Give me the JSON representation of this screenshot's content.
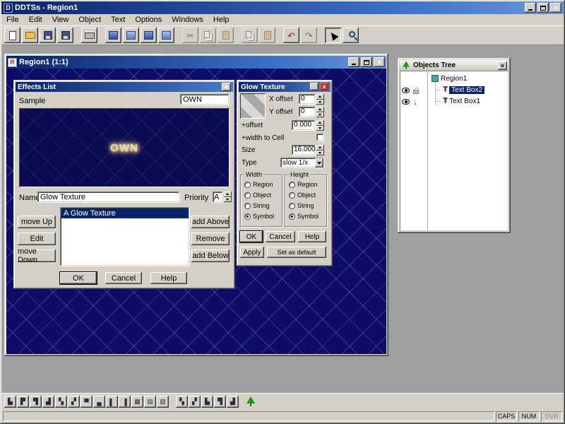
{
  "app": {
    "title": "DDTSs - Region1",
    "menu": [
      "File",
      "Edit",
      "View",
      "Object",
      "Text",
      "Options",
      "Windows",
      "Help"
    ],
    "statusbar": {
      "caps": "CAPS",
      "num": "NUM",
      "ovr": "OVR"
    }
  },
  "region_window": {
    "title": "Region1  (1:1)"
  },
  "effects": {
    "title": "Effects List",
    "sample_label": "Sample",
    "sample_value": "OWN",
    "preview_text": "OWN",
    "name_label": "Name",
    "name_value": "Glow Texture",
    "priority_label": "Priority",
    "priority_value": "A",
    "list_items": [
      "A Glow Texture"
    ],
    "btn_move_up": "move Up",
    "btn_edit": "Edit",
    "btn_move_down": "move Down",
    "btn_add_above": "add Above",
    "btn_remove": "Remove",
    "btn_add_below": "add Below",
    "btn_ok": "OK",
    "btn_cancel": "Cancel",
    "btn_help": "Help"
  },
  "glow": {
    "title": "Glow Texture",
    "x_offset_label": "X offset",
    "x_offset_value": "0",
    "y_offset_label": "Y offset",
    "y_offset_value": "0",
    "plus_offset_label": "+offset",
    "plus_offset_value": "0.000",
    "width_to_cell_label": "+width to Cell",
    "size_label": "Size",
    "size_value": "16.000",
    "type_label": "Type",
    "type_value": "slow 1/x",
    "width_group": {
      "label": "Width",
      "options": [
        "Region",
        "Object",
        "String",
        "Symbol"
      ],
      "selected": "Symbol"
    },
    "height_group": {
      "label": "Height",
      "options": [
        "Region",
        "Object",
        "String",
        "Symbol"
      ],
      "selected": "Symbol"
    },
    "btn_ok": "OK",
    "btn_cancel": "Cancel",
    "btn_help": "Help",
    "btn_apply": "Apply",
    "btn_set_default": "Set as default"
  },
  "objects_tree": {
    "title": "Objects Tree",
    "root": "Region1",
    "children": [
      "Text Box2",
      "Text Box1"
    ],
    "selected": "Text Box2"
  },
  "icons": {
    "app_glyph": "D",
    "region_glyph": "R",
    "close": "×",
    "cut": "✂",
    "undo": "↶",
    "redo": "↷",
    "down_arrow": "↓",
    "text_glyph": "T",
    "align": [
      "▙",
      "▛",
      "▜",
      "▟",
      "▚",
      "▞",
      "▀",
      "▄",
      "▌",
      "▐",
      "▦",
      "▤",
      "▥"
    ],
    "align2": [
      "▚",
      "▞",
      "▙",
      "▜",
      "▟"
    ]
  }
}
